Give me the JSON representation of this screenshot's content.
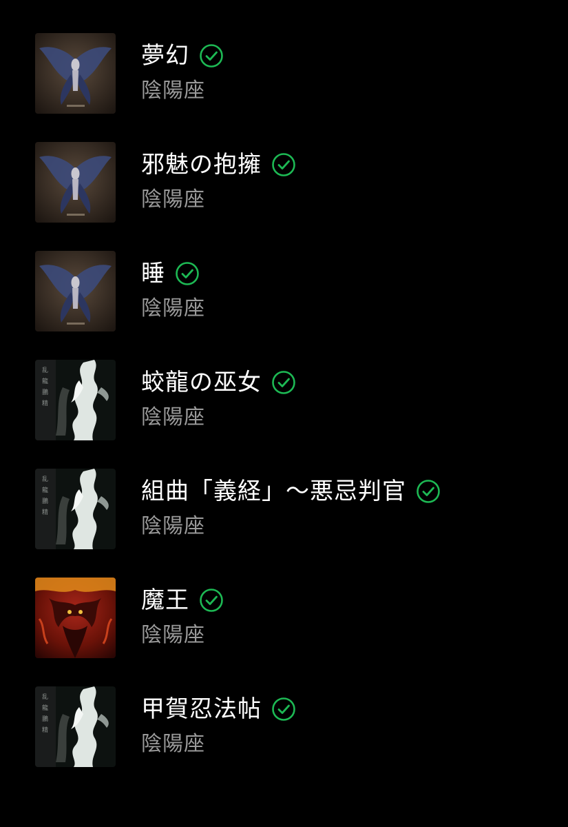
{
  "colors": {
    "background": "#000000",
    "title": "#ffffff",
    "artist": "#9a9a9a",
    "downloaded_check": "#1db954"
  },
  "tracks": [
    {
      "title": "夢幻",
      "artist": "陰陽座",
      "cover": "butterfly-angel-cover",
      "downloaded": true
    },
    {
      "title": "邪魅の抱擁",
      "artist": "陰陽座",
      "cover": "butterfly-angel-cover",
      "downloaded": true
    },
    {
      "title": "睡",
      "artist": "陰陽座",
      "cover": "butterfly-angel-cover",
      "downloaded": true
    },
    {
      "title": "蛟龍の巫女",
      "artist": "陰陽座",
      "cover": "white-dragon-cover",
      "downloaded": true
    },
    {
      "title": "組曲「義経」～悪忌判官",
      "artist": "陰陽座",
      "cover": "white-dragon-cover",
      "downloaded": true
    },
    {
      "title": "魔王",
      "artist": "陰陽座",
      "cover": "red-demon-cover",
      "downloaded": true
    },
    {
      "title": "甲賀忍法帖",
      "artist": "陰陽座",
      "cover": "white-dragon-cover",
      "downloaded": true
    }
  ]
}
